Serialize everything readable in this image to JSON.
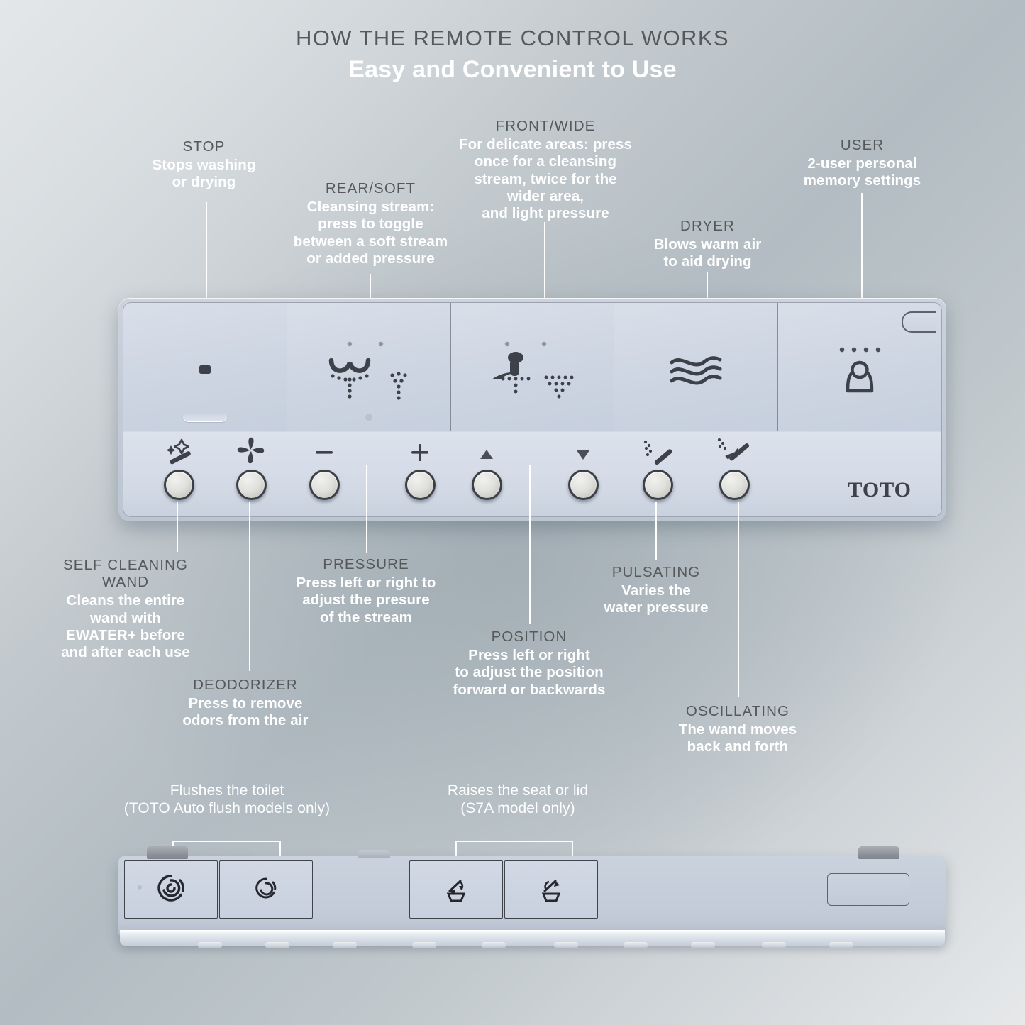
{
  "header": {
    "title": "HOW THE REMOTE CONTROL WORKS",
    "subtitle": "Easy and Convenient to Use"
  },
  "top_callouts": [
    {
      "id": "stop",
      "heading": "STOP",
      "body": "Stops washing\nor drying"
    },
    {
      "id": "rear_soft",
      "heading": "REAR/SOFT",
      "body": "Cleansing stream:\npress to toggle\nbetween a soft stream\nor added pressure"
    },
    {
      "id": "front_wide",
      "heading": "FRONT/WIDE",
      "body": "For delicate areas: press\nonce for a cleansing\nstream,  twice for the\nwider area,\nand light pressure"
    },
    {
      "id": "dryer",
      "heading": "DRYER",
      "body": "Blows warm air\nto aid drying"
    },
    {
      "id": "user",
      "heading": "USER",
      "body": "2-user personal\nmemory settings"
    }
  ],
  "bottom_callouts": [
    {
      "id": "self_cleaning_wand",
      "heading": "SELF CLEANING\nWAND",
      "body": "Cleans the entire\nwand with\nEWATER+ before\nand after each use"
    },
    {
      "id": "deodorizer",
      "heading": "DEODORIZER",
      "body": "Press to remove\nodors from the air"
    },
    {
      "id": "pressure",
      "heading": "PRESSURE",
      "body": "Press left or right to\nadjust the presure\nof the stream"
    },
    {
      "id": "position",
      "heading": "POSITION",
      "body": "Press left or right\nto adjust the position\nforward or backwards"
    },
    {
      "id": "pulsating",
      "heading": "PULSATING",
      "body": "Varies the\nwater pressure"
    },
    {
      "id": "oscillating",
      "heading": "OSCILLATING",
      "body": "The wand moves\nback and forth"
    }
  ],
  "edge_callouts": [
    {
      "id": "flush",
      "line1": "Flushes the toilet",
      "line2": "(TOTO Auto flush models only)"
    },
    {
      "id": "seat_lid",
      "line1": "Raises the seat or lid",
      "line2": "(S7A model only)"
    }
  ],
  "remote": {
    "brand": "TOTO",
    "top_buttons": [
      {
        "id": "stop",
        "icon": "stop-square-icon"
      },
      {
        "id": "rear_soft",
        "icon": "rear-soft-spray-icon"
      },
      {
        "id": "front_wide",
        "icon": "front-wide-spray-icon"
      },
      {
        "id": "dryer",
        "icon": "dryer-waves-icon"
      },
      {
        "id": "user",
        "icon": "user-person-icon"
      }
    ],
    "round_buttons": [
      {
        "id": "self_cleaning_wand",
        "icon": "sparkle-wand-icon"
      },
      {
        "id": "deodorizer",
        "icon": "fan-icon"
      },
      {
        "id": "pressure_down",
        "icon": "minus-icon"
      },
      {
        "id": "pressure_up",
        "icon": "plus-icon"
      },
      {
        "id": "position_up",
        "icon": "triangle-up-icon"
      },
      {
        "id": "position_down",
        "icon": "triangle-down-icon"
      },
      {
        "id": "pulsating",
        "icon": "pulsating-wand-icon"
      },
      {
        "id": "oscillating",
        "icon": "oscillating-wand-icon"
      }
    ],
    "edge_buttons": [
      {
        "id": "flush_full",
        "icon": "flush-spiral-large-icon"
      },
      {
        "id": "flush_light",
        "icon": "flush-spiral-small-icon"
      },
      {
        "id": "blank",
        "icon": "blank-icon"
      },
      {
        "id": "raise_seat",
        "icon": "raise-seat-icon"
      },
      {
        "id": "raise_lid",
        "icon": "raise-lid-icon"
      }
    ]
  },
  "colors": {
    "heading": "#55595c",
    "body": "#ffffff",
    "icon_dark": "#3d4149",
    "remote_face": "#d2d9e5"
  }
}
